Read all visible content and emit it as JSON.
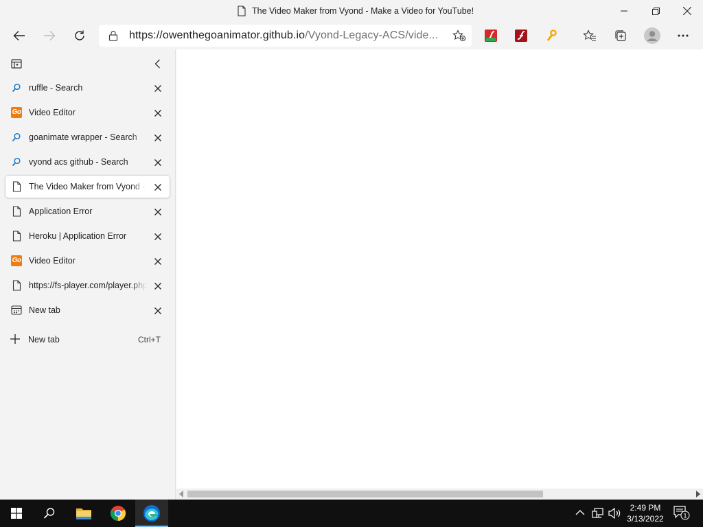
{
  "window": {
    "title": "The Video Maker from Vyond - Make a Video for YouTube!"
  },
  "toolbar": {
    "url_host": "https://owenthegoanimator.github.io",
    "url_path": "/Vyond-Legacy-ACS/vide..."
  },
  "sidebar": {
    "tabs": [
      {
        "label": "ruffle - Search",
        "icon": "search-icon",
        "active": false
      },
      {
        "label": "Video Editor",
        "icon": "goanimate-icon",
        "active": false
      },
      {
        "label": "goanimate wrapper - Search",
        "icon": "search-icon",
        "active": false
      },
      {
        "label": "vyond acs github - Search",
        "icon": "search-icon",
        "active": false
      },
      {
        "label": "The Video Maker from Vyond - Make a Video for YouTube!",
        "icon": "page-icon",
        "active": true
      },
      {
        "label": "Application Error",
        "icon": "page-icon",
        "active": false
      },
      {
        "label": "Heroku | Application Error",
        "icon": "page-icon",
        "active": false
      },
      {
        "label": "Video Editor",
        "icon": "goanimate-icon",
        "active": false
      },
      {
        "label": "https://fs-player.com/player.php?",
        "icon": "page-icon",
        "active": false
      },
      {
        "label": "New tab",
        "icon": "newtab-icon",
        "active": false
      }
    ],
    "new_tab_label": "New tab",
    "new_tab_shortcut": "Ctrl+T"
  },
  "favicon_text": {
    "goanimate": "Go"
  },
  "taskbar": {
    "time": "2:49 PM",
    "date": "3/13/2022",
    "notification_count": "1"
  },
  "colors": {
    "accent_edge": "#0c6fd6",
    "taskbar_bg": "#101010",
    "goanimate_orange": "#f07c10"
  }
}
